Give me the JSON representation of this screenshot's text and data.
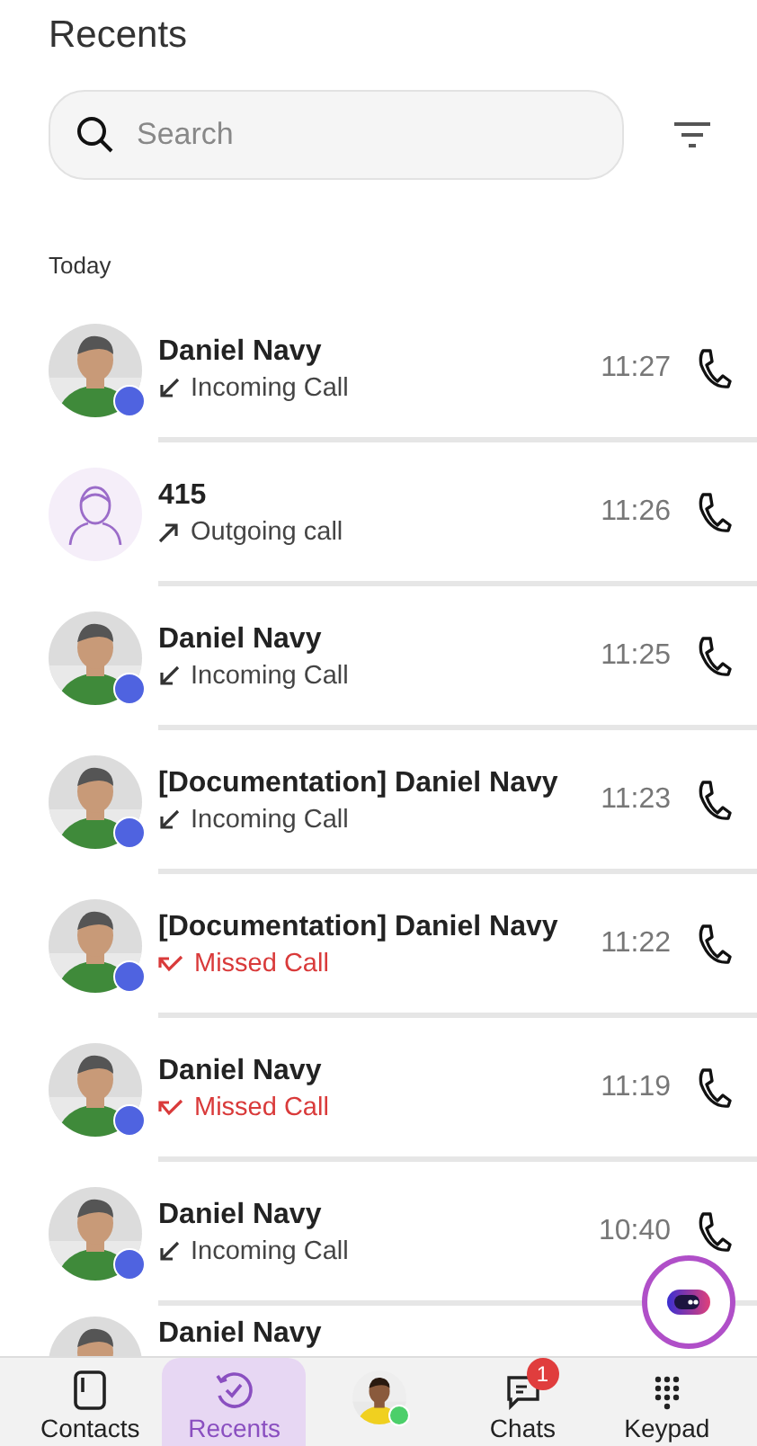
{
  "title": "Recents",
  "search": {
    "placeholder": "Search"
  },
  "section": "Today",
  "calls": [
    {
      "name": "Daniel Navy",
      "kind": "incoming",
      "label": "Incoming Call",
      "time": "11:27",
      "status": true
    },
    {
      "name": "415",
      "kind": "outgoing",
      "label": "Outgoing call",
      "time": "11:26",
      "avatar": {
        "kind": "generic"
      },
      "status": false
    },
    {
      "name": "Daniel Navy",
      "kind": "incoming",
      "label": "Incoming Call",
      "time": "11:25",
      "status": true
    },
    {
      "name": "[Documentation] Daniel Navy",
      "kind": "incoming",
      "label": "Incoming Call",
      "time": "11:23",
      "status": true
    },
    {
      "name": "[Documentation] Daniel Navy",
      "kind": "missed",
      "label": "Missed Call",
      "time": "11:22",
      "status": true
    },
    {
      "name": "Daniel Navy",
      "kind": "missed",
      "label": "Missed Call",
      "time": "11:19",
      "status": true
    },
    {
      "name": "Daniel Navy",
      "kind": "incoming",
      "label": "Incoming Call",
      "time": "10:40",
      "status": true
    },
    {
      "name": "Daniel Navy"
    }
  ],
  "nav": [
    {
      "kind": "contacts",
      "label": "Contacts",
      "selected": false
    },
    {
      "kind": "recents",
      "label": "Recents",
      "selected": true
    },
    {
      "kind": "me",
      "online": true,
      "selected": false
    },
    {
      "kind": "chats",
      "label": "Chats",
      "badge": "1",
      "selected": false
    },
    {
      "kind": "keypad",
      "label": "Keypad",
      "selected": false
    }
  ]
}
